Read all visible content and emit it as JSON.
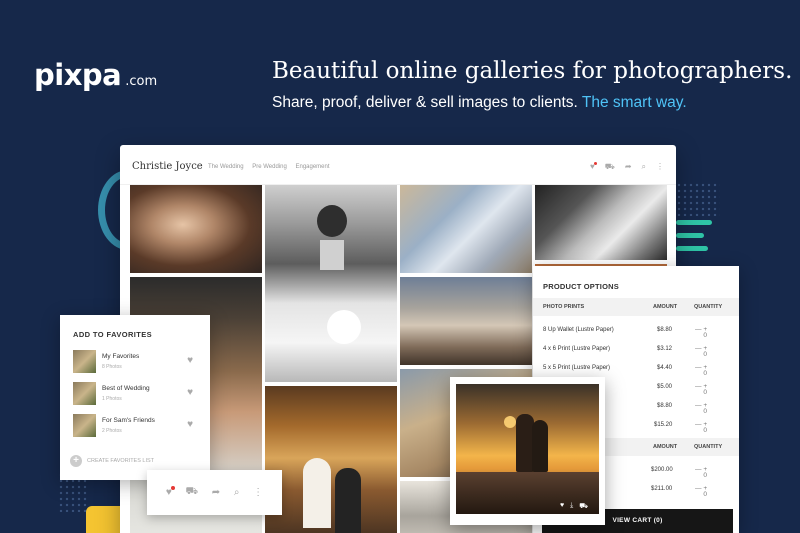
{
  "brand": {
    "name": "pixpa",
    "domain": ".com"
  },
  "headline": "Beautiful online galleries for photographers.",
  "subline": {
    "text": "Share, proof, deliver & sell images to clients.",
    "accent": "The smart way."
  },
  "colors": {
    "background": "#16284a",
    "accent": "#4fc3f7",
    "favorite_dot": "#e53935"
  },
  "gallery": {
    "title": "Christie Joyce",
    "nav": [
      "The Wedding",
      "Pre Wedding",
      "Engagement"
    ],
    "icons": [
      "heart-icon",
      "cart-icon",
      "share-icon",
      "search-icon",
      "more-icon"
    ]
  },
  "favorites": {
    "title": "ADD TO FAVORITES",
    "items": [
      {
        "name": "My Favorites",
        "count": "8 Photos"
      },
      {
        "name": "Best of Wedding",
        "count": "1 Photos"
      },
      {
        "name": "For Sam's Friends",
        "count": "2 Photos"
      }
    ],
    "create_label": "CREATE FAVORITES LIST"
  },
  "products": {
    "title": "PRODUCT OPTIONS",
    "headers": {
      "group1": "PHOTO PRINTS",
      "amount": "AMOUNT",
      "quantity": "QUANTITY"
    },
    "rows": [
      {
        "name": "8 Up Wallet (Lustre Paper)",
        "amount": "$8.80",
        "qty": "0"
      },
      {
        "name": "4 x 6 Print (Lustre Paper)",
        "amount": "$3.12",
        "qty": "0"
      },
      {
        "name": "5 x 5 Print (Lustre Paper)",
        "amount": "$4.40",
        "qty": "0"
      },
      {
        "name": "",
        "amount": "$5.00",
        "qty": "0"
      },
      {
        "name": "",
        "amount": "$8.80",
        "qty": "0"
      },
      {
        "name": "",
        "amount": "$15.20",
        "qty": "0"
      }
    ],
    "headers2": {
      "amount": "AMOUNT",
      "quantity": "QUANTITY"
    },
    "rows2": [
      {
        "amount": "$200.00",
        "qty": "0"
      },
      {
        "amount": "$211.00",
        "qty": "0"
      }
    ],
    "cart_label": "VIEW CART (0)"
  }
}
